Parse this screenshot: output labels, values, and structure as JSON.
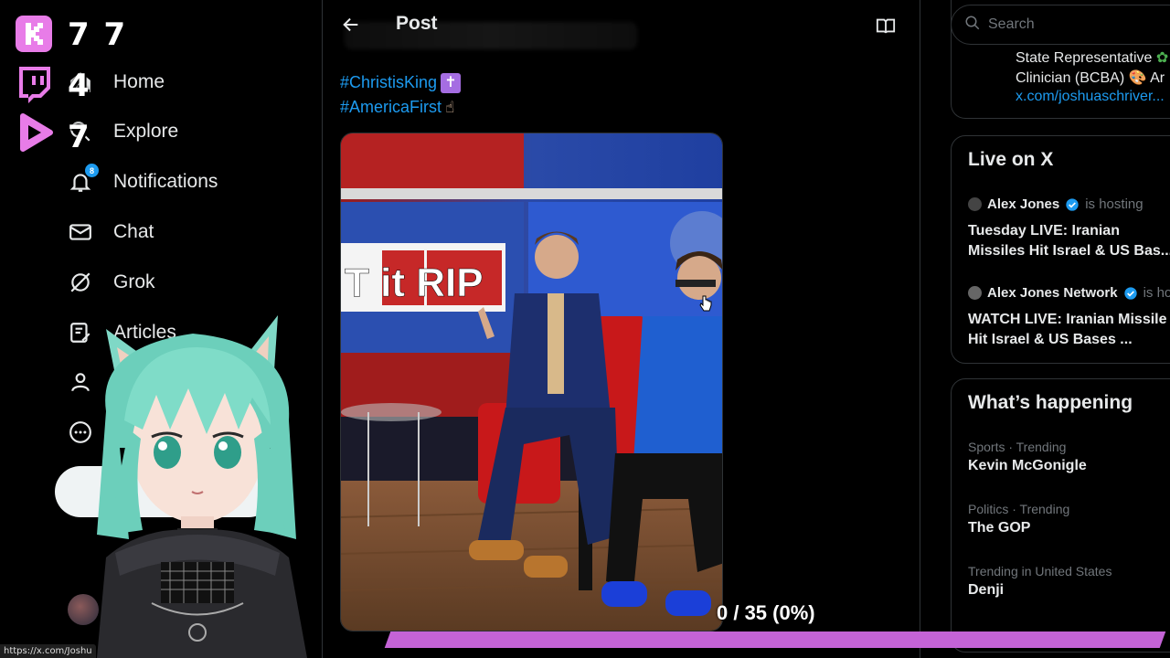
{
  "overlay": {
    "counts": [
      "7 7",
      "4",
      "7"
    ],
    "progress_text": "0 / 35 (0%)",
    "progress_fraction": 0.0
  },
  "nav": {
    "items": [
      {
        "label": "Home",
        "icon": "home-icon"
      },
      {
        "label": "Explore",
        "icon": "search-icon"
      },
      {
        "label": "Notifications",
        "icon": "bell-icon",
        "badge": "8"
      },
      {
        "label": "Chat",
        "icon": "envelope-icon"
      },
      {
        "label": "Grok",
        "icon": "grok-icon"
      },
      {
        "label": "Articles",
        "icon": "articles-icon"
      }
    ]
  },
  "main": {
    "title": "Post",
    "hashtags": [
      "#ChristisKing",
      "#AmericaFirst"
    ],
    "photo_sign": "T it RIP"
  },
  "right": {
    "search_placeholder": "Search",
    "bio": {
      "line1": "State Representative",
      "line2": "Clinician (BCBA)",
      "line2_suffix": "Ar",
      "link": "x.com/joshuaschriver..."
    },
    "live": {
      "title": "Live on X",
      "entries": [
        {
          "host": "Alex Jones",
          "sub": "is hosting",
          "title1": "Tuesday LIVE: Iranian",
          "title2": "Missiles Hit Israel & US Bas..."
        },
        {
          "host": "Alex Jones Network",
          "sub": "is hos",
          "title1": "WATCH LIVE: Iranian Missile",
          "title2": "Hit Israel & US Bases ..."
        }
      ]
    },
    "happening": {
      "title": "What’s happening",
      "trends": [
        {
          "meta": "Sports · Trending",
          "name": "Kevin McGonigle"
        },
        {
          "meta": "Politics · Trending",
          "name": "The GOP"
        },
        {
          "meta": "Trending in United States",
          "name": "Denji"
        }
      ]
    }
  },
  "status_url": "https://x.com/Joshu",
  "colors": {
    "accent": "#1d9bf0",
    "progress": "#c463d6",
    "overlay_icon": "#e87ce8"
  }
}
